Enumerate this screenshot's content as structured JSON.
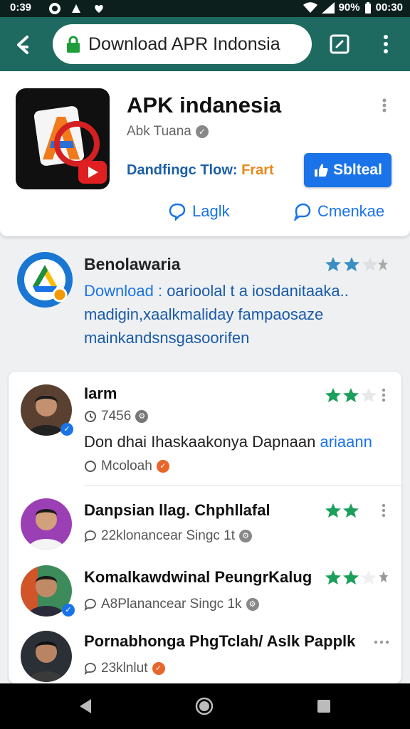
{
  "status_bar": {
    "time": "0:39",
    "battery": "90%",
    "clock_right": "00:30"
  },
  "browser": {
    "url_text": "Download APR Indonsia"
  },
  "app": {
    "title": "APK indanesia",
    "developer": "Abk Tuana",
    "download_prefix": "Dandfingc Tlow: ",
    "download_highlight": "Frart",
    "install_label": "Sblteal",
    "action_left": "Laglk",
    "action_right": "Cmenkae"
  },
  "info": {
    "title": "Benolawaria",
    "desc_lead": "Download :",
    "desc_rest": " oarioolal t a iosdanitaaka..",
    "desc_line2": "madigin,xaalkmaliday fampaosaze",
    "desc_line3": "mainkandsnsgasoorifen",
    "rating_filled": 2,
    "rating_total": 3
  },
  "reviews": [
    {
      "name": "Iarm",
      "meta": "7456",
      "text_prefix": "Don dhai",
      "text_mid": " Ihaskaakonya Dapnaan ",
      "text_highlight": "ariaann",
      "sub_meta": "Mcoloah",
      "stars_filled": 2
    },
    {
      "name": "Danpsian llag. Chphllafal",
      "meta": "22klonancear  Singc 1t",
      "stars_filled": 2
    },
    {
      "name": "Komalkawdwinal PeungrKalug",
      "meta": "A8Planancear  Singc 1k",
      "stars_filled": 2
    },
    {
      "name": "Pornabhonga PhgTclah/ Aslk Papplk",
      "meta": "23klnlut",
      "stars_filled": 0
    }
  ],
  "colors": {
    "toolbar": "#1e6a61",
    "accent_blue": "#1a73e8",
    "star_green": "#1aa05a",
    "star_blue": "#3a8ec4"
  }
}
